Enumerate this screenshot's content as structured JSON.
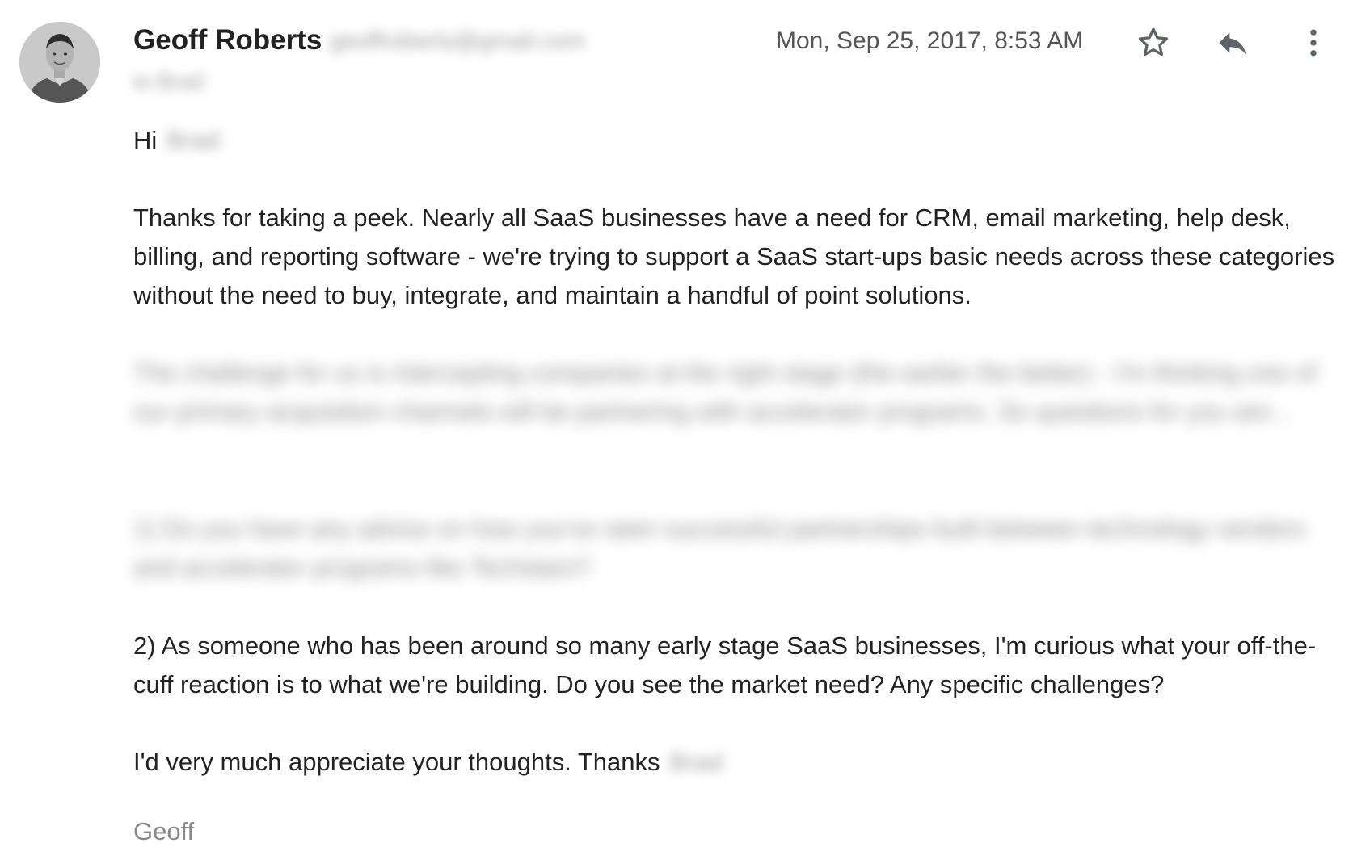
{
  "sender": {
    "name": "Geoff Roberts",
    "email": "geoffroberts@gmail.com",
    "recipient": "to Brad"
  },
  "timestamp": "Mon, Sep 25, 2017, 8:53 AM",
  "actions": {
    "star_icon": "star-outline-icon",
    "reply_icon": "reply-icon",
    "more_icon": "more-vertical-icon"
  },
  "body": {
    "greeting": "Hi",
    "greeting_name": "Brad",
    "paragraph_1": "Thanks for taking a peek. Nearly all SaaS businesses have a need for CRM, email marketing, help desk, billing, and reporting software - we're trying to support a SaaS start-ups basic needs across these categories without the need to buy, integrate, and maintain a handful of point solutions.",
    "paragraph_2_blurred": "The challenge for us is intercepting companies at the right stage (the earlier the better) - I'm thinking one of our primary acquisition channels will be partnering with accelerator programs. So questions for you are...",
    "paragraph_3_blurred": "1) Do you have any advice on how you've seen successful partnerships built between technology vendors and accelerator programs like Techstars?",
    "paragraph_4": "2) As someone who has been around so many early stage SaaS businesses, I'm curious what your off-the-cuff reaction is to what we're building. Do you see the market need? Any specific challenges?",
    "paragraph_5": "I'd very much appreciate your thoughts. Thanks",
    "thanks_name": "Brad",
    "signature": "Geoff"
  },
  "colors": {
    "text": "#222222",
    "muted": "#555555",
    "icon": "#5f6368",
    "blur": "#9e9e9e"
  }
}
